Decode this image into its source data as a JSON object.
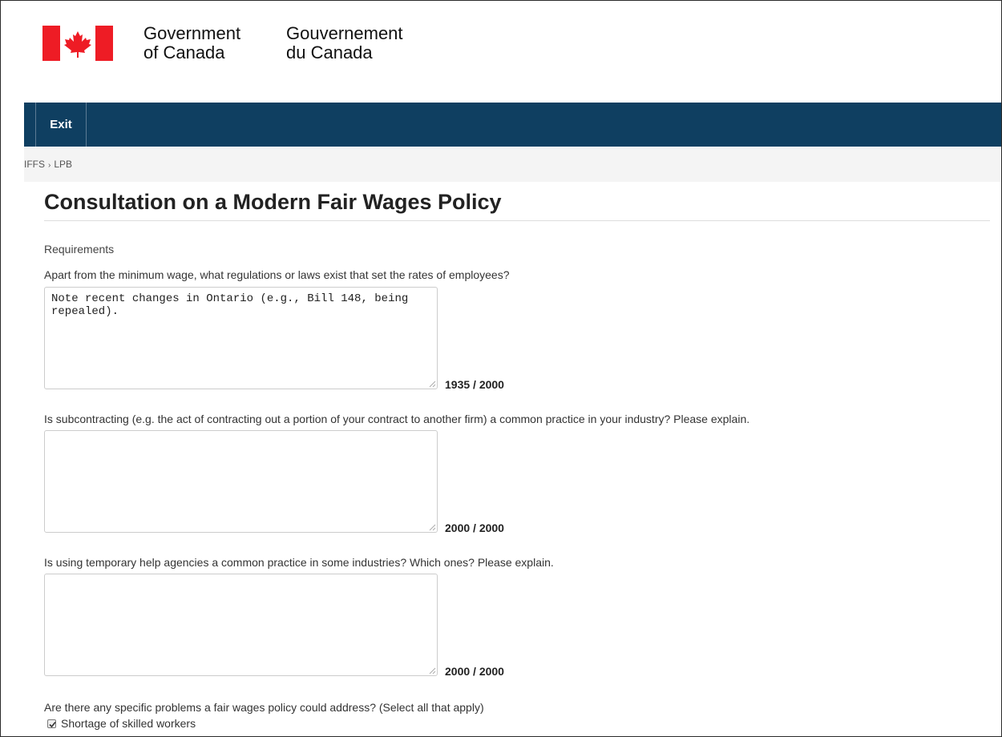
{
  "header": {
    "signature_en_line1": "Government",
    "signature_en_line2": "of Canada",
    "signature_fr_line1": "Gouvernement",
    "signature_fr_line2": "du Canada",
    "flag_color": "#ee1c25"
  },
  "nav": {
    "exit_label": "Exit",
    "bar_color": "#0f3f61"
  },
  "breadcrumb": {
    "items": [
      "IFFS",
      "LPB"
    ],
    "separator": "›"
  },
  "page": {
    "title": "Consultation on a Modern Fair Wages Policy",
    "section_label": "Requirements"
  },
  "questions": [
    {
      "label": "Apart from the minimum wage, what regulations or laws exist that set the rates of employees?",
      "value": "Note recent changes in Ontario (e.g., Bill 148, being repealed).",
      "char_count": "1935 / 2000"
    },
    {
      "label": "Is subcontracting (e.g. the act of contracting out a portion of your contract to another firm) a common practice in your industry? Please explain.",
      "value": "",
      "char_count": "2000 / 2000"
    },
    {
      "label": "Is using temporary help agencies a common practice in some industries? Which ones? Please explain.",
      "value": "",
      "char_count": "2000 / 2000"
    }
  ],
  "problems": {
    "label": "Are there any specific problems a fair wages policy could address? (Select all that apply)",
    "options": [
      {
        "label": "Shortage of skilled workers",
        "checked": true
      }
    ]
  }
}
